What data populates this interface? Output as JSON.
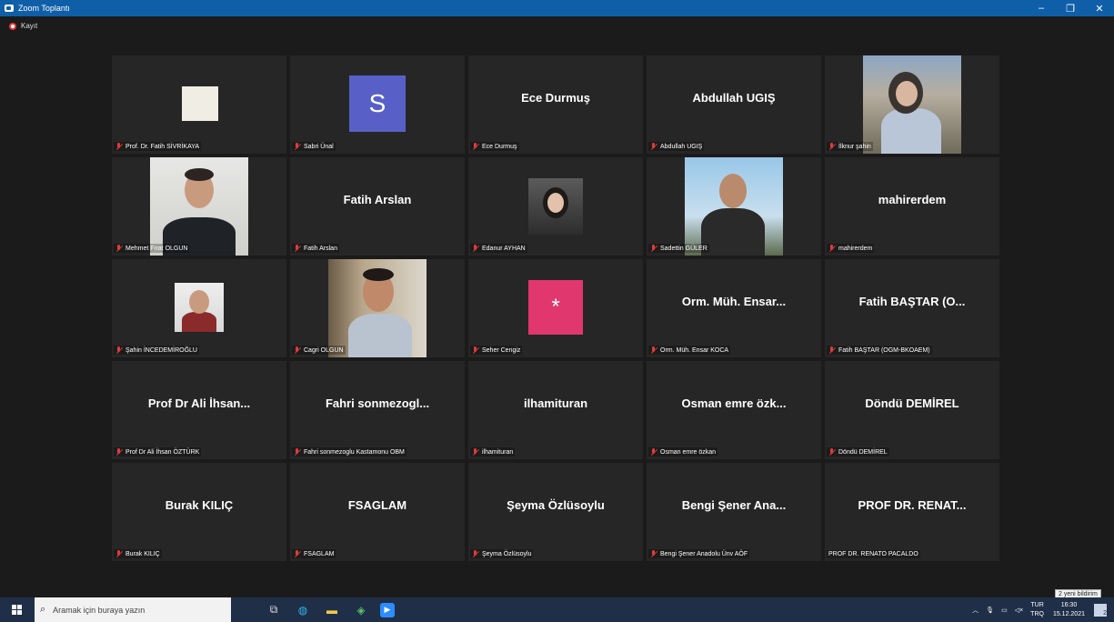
{
  "window": {
    "title": "Zoom Toplantı",
    "controls": [
      "–",
      "❐",
      "✕"
    ]
  },
  "recording": {
    "label": "Kayıt"
  },
  "participants": [
    {
      "display": "",
      "label": "Prof. Dr. Fatih SİVRİKAYA",
      "muted": true
    },
    {
      "display": "S",
      "label": "Sabri Ünal",
      "muted": true
    },
    {
      "display": "Ece Durmuş",
      "label": "Ece Durmuş",
      "muted": true
    },
    {
      "display": "Abdullah UGIŞ",
      "label": "Abdullah UGIŞ",
      "muted": true
    },
    {
      "display": "",
      "label": "İlknur şahin",
      "muted": true
    },
    {
      "display": "",
      "label": "Mehmet Fırat OLGUN",
      "muted": true
    },
    {
      "display": "Fatih Arslan",
      "label": "Fatih Arslan",
      "muted": true
    },
    {
      "display": "",
      "label": "Edanur AYHAN",
      "muted": true
    },
    {
      "display": "",
      "label": "Sadettin GÜLER",
      "muted": true
    },
    {
      "display": "mahirerdem",
      "label": "mahirerdem",
      "muted": true
    },
    {
      "display": "",
      "label": "Şahin İNCEDEMİROĞLU",
      "muted": true
    },
    {
      "display": "",
      "label": "Cagri OLGUN",
      "muted": true
    },
    {
      "display": "*",
      "label": "Seher Cengiz",
      "muted": true
    },
    {
      "display": "Orm. Müh. Ensar...",
      "label": "Orm. Müh. Ensar KOCA",
      "muted": true
    },
    {
      "display": "Fatih BAŞTAR (O...",
      "label": "Fatih BAŞTAR (OGM-BKOAEM)",
      "muted": true
    },
    {
      "display": "Prof Dr Ali İhsan...",
      "label": "Prof Dr Ali İhsan ÖZTÜRK",
      "muted": true
    },
    {
      "display": "Fahri sonmezogl...",
      "label": "Fahri sonmezoglu Kastamonu OBM",
      "muted": true
    },
    {
      "display": "ilhamituran",
      "label": "ilhamituran",
      "muted": true
    },
    {
      "display": "Osman emre özk...",
      "label": "Osman emre özkan",
      "muted": true
    },
    {
      "display": "Döndü DEMİREL",
      "label": "Döndü DEMİREL",
      "muted": true
    },
    {
      "display": "Burak KILIÇ",
      "label": "Burak KILIÇ",
      "muted": true
    },
    {
      "display": "FSAGLAM",
      "label": "FSAGLAM",
      "muted": true
    },
    {
      "display": "Şeyma Özlüsoylu",
      "label": "Şeyma Özlüsoylu",
      "muted": true
    },
    {
      "display": "Bengi Şener Ana...",
      "label": "Bengi Şener Anadolu Ünv AÖF",
      "muted": true
    },
    {
      "display": "PROF DR. RENAT...",
      "label": "PROF DR. RENATO PACALDO",
      "muted": false
    }
  ],
  "notification": {
    "text": "2 yeni bildirim"
  },
  "taskbar": {
    "search_placeholder": "Aramak için buraya yazın",
    "language": {
      "line1": "TUR",
      "line2": "TRQ"
    },
    "clock": {
      "time": "16:30",
      "date": "15.12.2021"
    },
    "notif_count": "2"
  },
  "colors": {
    "titlebar": "#0f5ea8",
    "tile_bg": "#262626",
    "mute": "#e03b3b",
    "avatar_s": "#5860c8",
    "avatar_pink": "#e0376e",
    "taskbar": "#1f2f48"
  }
}
